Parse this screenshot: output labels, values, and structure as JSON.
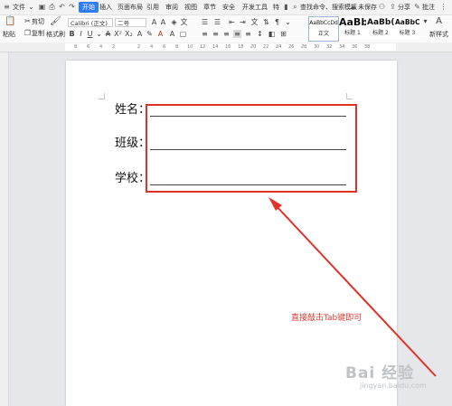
{
  "menubar": {
    "file": "文件",
    "tabs": [
      "开始",
      "插入",
      "页面布局",
      "引用",
      "审阅",
      "视图",
      "章节",
      "安全",
      "开发工具",
      "特"
    ],
    "search_placeholder": "查找命令、搜索模板",
    "unsaved": "未保存",
    "share": "分享",
    "comment": "批注"
  },
  "ribbon": {
    "paste": "粘贴",
    "cut": "剪切",
    "copy": "复制",
    "format_painter": "格式刷",
    "font_family": "Calibri (正文)",
    "font_size": "二号",
    "styles": [
      {
        "sample": "AaBbCcDd",
        "name": "正文"
      },
      {
        "sample": "AaBb",
        "name": "标题 1"
      },
      {
        "sample": "AaBb(",
        "name": "标题 2"
      },
      {
        "sample": "AaBbCc",
        "name": "标题 3"
      }
    ],
    "new_style": "新样式"
  },
  "ruler": {
    "numbers": [
      "8",
      "6",
      "4",
      "2",
      "",
      "2",
      "4",
      "6",
      "8",
      "10",
      "12",
      "14",
      "16",
      "18",
      "20",
      "22",
      "24",
      "26",
      "28",
      "30",
      "32",
      "34",
      "36",
      "38"
    ]
  },
  "document": {
    "fields": [
      {
        "label": "姓名："
      },
      {
        "label": "班级："
      },
      {
        "label": "学校："
      }
    ]
  },
  "annotation": "直接敲击Tab键即可",
  "watermark": {
    "brand": "Bai 经验",
    "url": "jingyan.baidu.com"
  },
  "colors": {
    "accent": "#2f7cf6",
    "annotation_red": "#e0322b"
  }
}
